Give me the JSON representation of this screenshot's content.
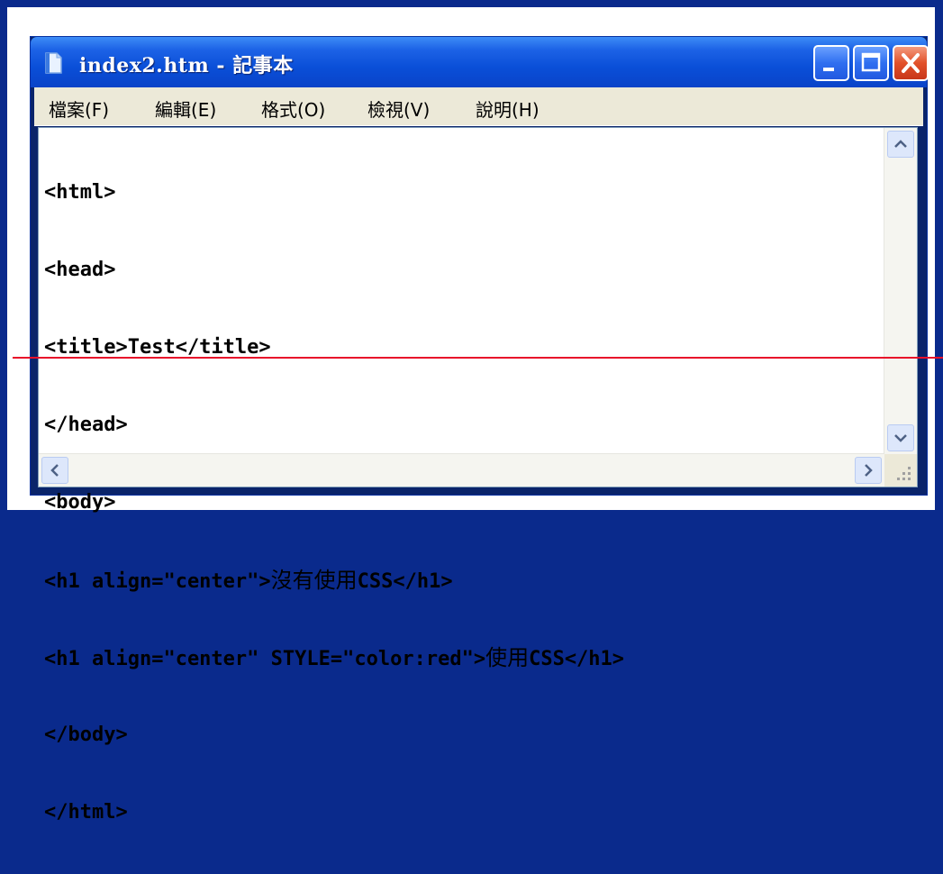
{
  "window": {
    "title": "index2.htm - 記事本",
    "controls": {
      "minimize": "minimize-button",
      "maximize": "maximize-button",
      "close": "close-button"
    }
  },
  "menu": {
    "items": [
      {
        "label": "檔案(F)"
      },
      {
        "label": "編輯(E)"
      },
      {
        "label": "格式(O)"
      },
      {
        "label": "檢視(V)"
      },
      {
        "label": "說明(H)"
      }
    ]
  },
  "editor": {
    "lines": [
      {
        "code": "<html>",
        "cjk": "",
        "tail": ""
      },
      {
        "code": "<head>",
        "cjk": "",
        "tail": ""
      },
      {
        "code": "<title>Test</title>",
        "cjk": "",
        "tail": ""
      },
      {
        "code": "</head>",
        "cjk": "",
        "tail": ""
      },
      {
        "code": "<body>",
        "cjk": "",
        "tail": ""
      },
      {
        "code": "<h1 align=\"center\">",
        "cjk": "沒有使用",
        "tail": "CSS</h1>"
      },
      {
        "code": "<h1 align=\"center\" STYLE=\"color:red\">",
        "cjk": "使用",
        "tail": "CSS</h1>"
      },
      {
        "code": "</body>",
        "cjk": "",
        "tail": ""
      },
      {
        "code": "</html>",
        "cjk": "",
        "tail": ""
      }
    ]
  },
  "icons": {
    "app": "notepad-icon",
    "scroll_up": "scroll-up-icon",
    "scroll_down": "scroll-down-icon",
    "scroll_left": "scroll-left-icon",
    "scroll_right": "scroll-right-icon",
    "grip": "resize-grip-icon"
  },
  "colors": {
    "slide_background": "#0a2a8c",
    "titlebar": "#0a4fd8",
    "close_button": "#e2512a",
    "annotation_line": "#e8102a"
  }
}
